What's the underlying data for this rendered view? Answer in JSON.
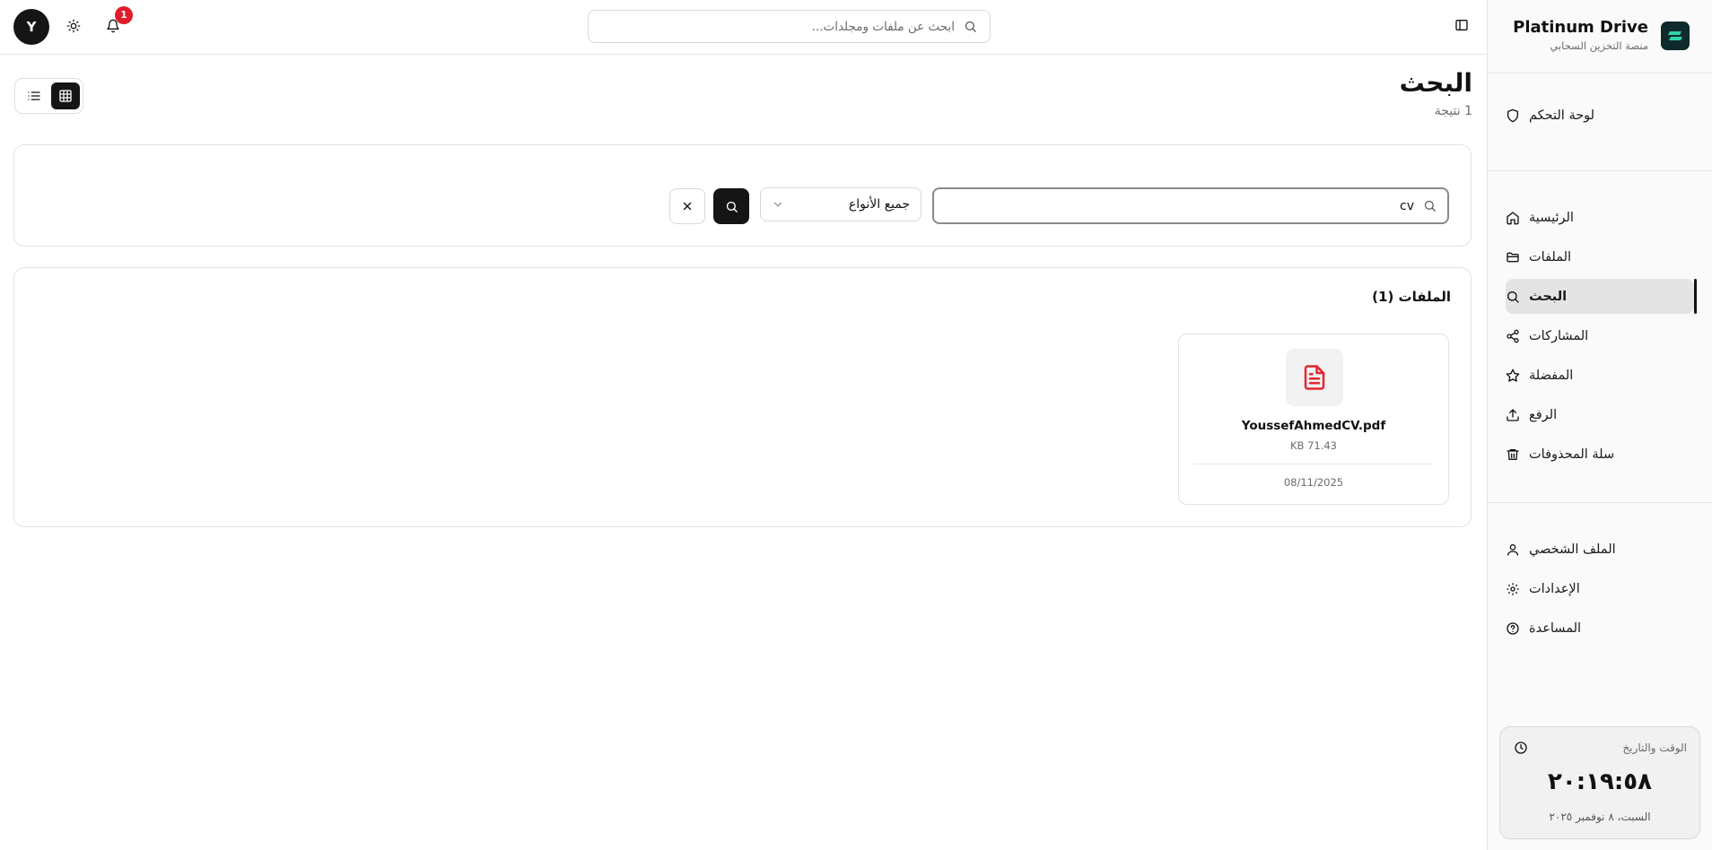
{
  "brand": {
    "title": "Platinum Drive",
    "subtitle": "منصة التخزين السحابي",
    "accent": "#2dd4a8"
  },
  "topbar": {
    "avatar_letter": "Y",
    "notifications_count": "1",
    "search_placeholder": "ابحث عن ملفات ومجلدات..."
  },
  "sidebar": {
    "dashboard_label": "لوحة التحكم",
    "items": [
      {
        "label": "الرئيسية",
        "icon": "home-icon"
      },
      {
        "label": "الملفات",
        "icon": "folder-icon"
      },
      {
        "label": "البحث",
        "icon": "search-icon",
        "active": true
      },
      {
        "label": "المشاركات",
        "icon": "share-icon"
      },
      {
        "label": "المفضلة",
        "icon": "star-icon"
      },
      {
        "label": "الرفع",
        "icon": "upload-icon"
      },
      {
        "label": "سلة المحذوفات",
        "icon": "trash-icon"
      }
    ],
    "account_items": [
      {
        "label": "الملف الشخصي",
        "icon": "user-icon"
      },
      {
        "label": "الإعدادات",
        "icon": "gear-icon"
      },
      {
        "label": "المساعدة",
        "icon": "help-icon"
      }
    ],
    "clock": {
      "label": "الوقت والتاريخ",
      "time": "٢٠:١٩:٥٨",
      "date": "السبت، ٨ نوفمبر ٢٠٢٥"
    }
  },
  "page": {
    "title": "البحث",
    "subtitle": "1 نتيجة",
    "view_mode": "grid"
  },
  "filters": {
    "query": "cv",
    "type_selected": "جميع الأنواع"
  },
  "results": {
    "heading": "الملفات (1)",
    "files": [
      {
        "name": "YoussefAhmedCV.pdf",
        "size": "KB 71.43",
        "date": "08/11/2025",
        "icon": "pdf-file-icon",
        "icon_color": "#e5262f"
      }
    ]
  }
}
